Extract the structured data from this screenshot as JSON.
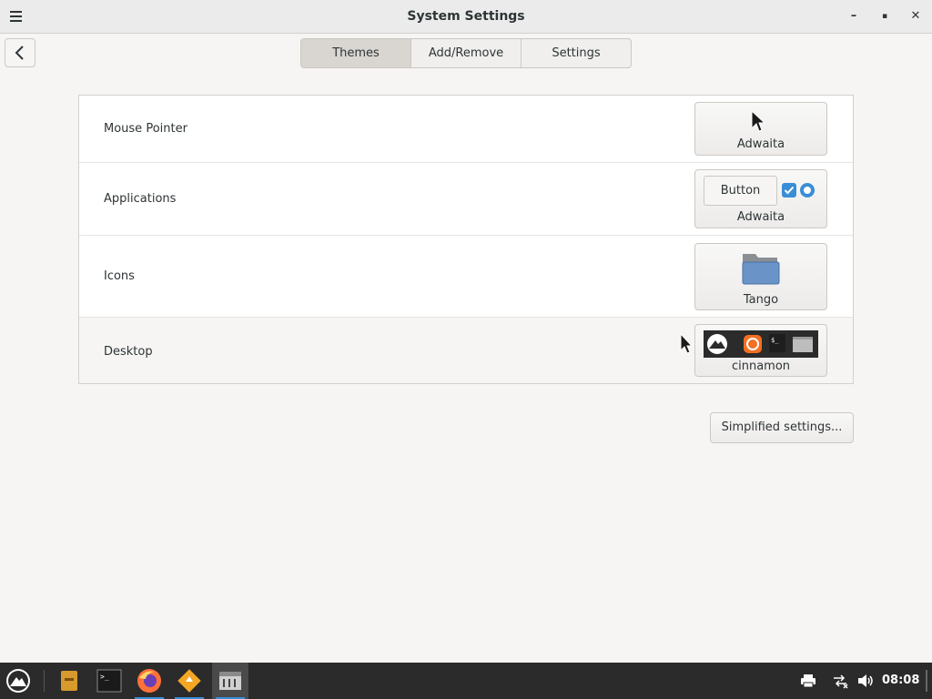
{
  "window": {
    "title": "System Settings",
    "minimize_glyph": "–",
    "maximize_glyph": "▪",
    "close_glyph": "✕"
  },
  "tabs": [
    {
      "label": "Themes",
      "active": true
    },
    {
      "label": "Add/Remove",
      "active": false
    },
    {
      "label": "Settings",
      "active": false
    }
  ],
  "themes": {
    "rows": [
      {
        "label": "Mouse Pointer",
        "value": "Adwaita"
      },
      {
        "label": "Applications",
        "value": "Adwaita",
        "preview_button_label": "Button"
      },
      {
        "label": "Icons",
        "value": "Tango"
      },
      {
        "label": "Desktop",
        "value": "cinnamon"
      }
    ]
  },
  "simplified_label": "Simplified settings...",
  "taskbar": {
    "clock": "08:08",
    "items": [
      "menu-icon",
      "file-manager-icon",
      "terminal-icon",
      "firefox-icon",
      "software-icon",
      "system-settings-icon"
    ]
  },
  "colors": {
    "accent": "#3a8ed6",
    "folder": "#6a94c8",
    "taskbar": "#2b2b2b",
    "updates_orange": "#f36f21"
  }
}
